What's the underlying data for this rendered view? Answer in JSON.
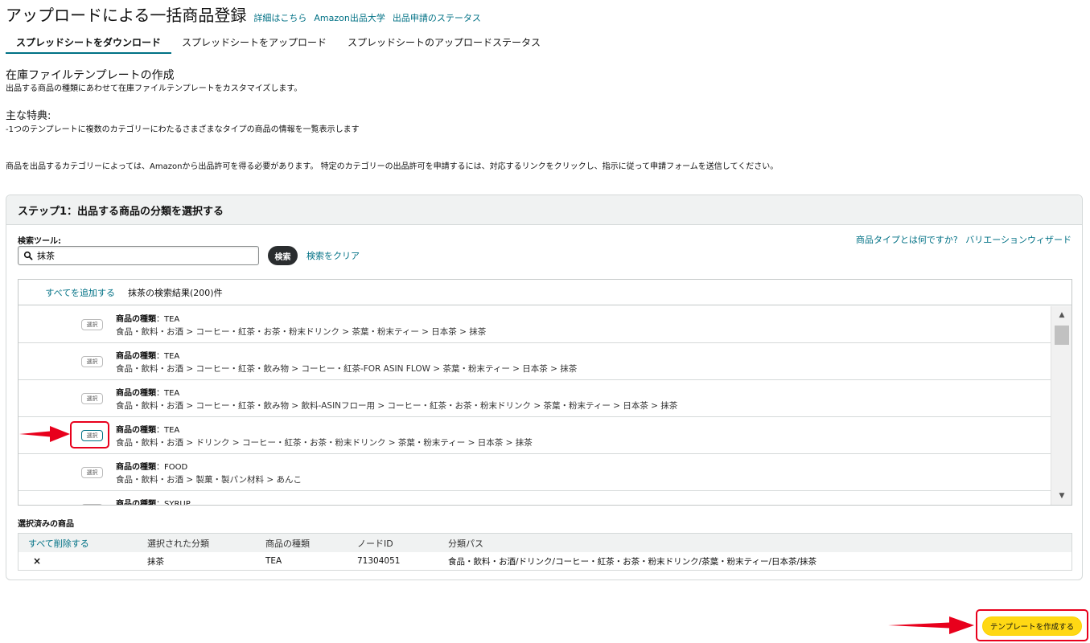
{
  "header": {
    "title": "アップロードによる一括商品登録",
    "links": [
      "詳細はこちら",
      "Amazon出品大学",
      "出品申請のステータス"
    ]
  },
  "tabs": [
    {
      "label": "スプレッドシートをダウンロード",
      "active": true
    },
    {
      "label": "スプレッドシートをアップロード",
      "active": false
    },
    {
      "label": "スプレッドシートのアップロードステータス",
      "active": false
    }
  ],
  "intro": {
    "title": "在庫ファイルテンプレートの作成",
    "description": "出品する商品の種類にあわせて在庫ファイルテンプレートをカスタマイズします。",
    "features_title": "主な特典:",
    "feature_item": "-1つのテンプレートに複数のカテゴリーにわたるさまざまなタイプの商品の情報を一覧表示します",
    "notice": "商品を出品するカテゴリーによっては、Amazonから出品許可を得る必要があります。 特定のカテゴリーの出品許可を申請するには、対応するリンクをクリックし、指示に従って申請フォームを送信してください。"
  },
  "step1": {
    "title": "ステップ1：出品する商品の分類を選択する",
    "search_label": "検索ツール:",
    "search_value": "抹茶",
    "search_button": "検索",
    "clear_link": "検索をクリア",
    "help_link": "商品タイプとは何ですか?",
    "variation_link": "バリエーションウィザード",
    "add_all": "すべてを追加する",
    "results_count": "抹茶の検索結果(200)件",
    "type_label": "商品の種類",
    "select_label": "選択",
    "results": [
      {
        "type": "TEA",
        "path": "食品・飲料・お酒 > コーヒー・紅茶・お茶・粉末ドリンク > 茶葉・粉末ティー > 日本茶 > 抹茶"
      },
      {
        "type": "TEA",
        "path": "食品・飲料・お酒 > コーヒー・紅茶・飲み物 > コーヒー・紅茶-FOR ASIN FLOW > 茶葉・粉末ティー > 日本茶 > 抹茶"
      },
      {
        "type": "TEA",
        "path": "食品・飲料・お酒 > コーヒー・紅茶・飲み物 > 飲料-ASINフロー用 > コーヒー・紅茶・お茶・粉末ドリンク > 茶葉・粉末ティー > 日本茶 > 抹茶"
      },
      {
        "type": "TEA",
        "path": "食品・飲料・お酒 > ドリンク > コーヒー・紅茶・お茶・粉末ドリンク > 茶葉・粉末ティー > 日本茶 > 抹茶"
      },
      {
        "type": "FOOD",
        "path": "食品・飲料・お酒 > 製菓・製パン材料 > あんこ"
      },
      {
        "type": "SYRUP",
        "path": ""
      }
    ]
  },
  "selected": {
    "title": "選択済みの商品",
    "remove_all": "すべて削除する",
    "columns": [
      "選択された分類",
      "商品の種類",
      "ノードID",
      "分類パス"
    ],
    "rows": [
      {
        "remove": "×",
        "category": "抹茶",
        "type": "TEA",
        "node_id": "71304051",
        "path": "食品・飲料・お酒/ドリンク/コーヒー・紅茶・お茶・粉末ドリンク/茶葉・粉末ティー/日本茶/抹茶"
      }
    ]
  },
  "create_button": "テンプレートを作成する",
  "colors": {
    "link": "#007185",
    "primary_button": "#ffd814",
    "annotation": "#e8001c",
    "dark_button": "#2a2d2f"
  }
}
